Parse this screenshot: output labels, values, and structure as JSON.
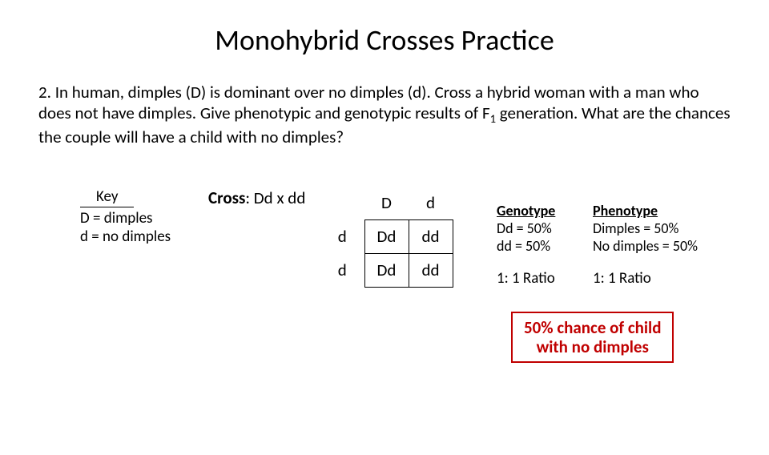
{
  "title": "Monohybrid Crosses Practice",
  "question_html": "2. In human, dimples (D) is dominant over no dimples (d). Cross a hybrid woman with a man who does not have dimples.  Give phenotypic and genotypic results of F<span class='sub'>1</span> generation.   What are the chances the couple will have a child with no dimples?",
  "key": {
    "heading": "Key",
    "line1": "D = dimples",
    "line2": "d = no dimples"
  },
  "cross": {
    "label": "Cross",
    "value": "Dd x dd"
  },
  "punnett": {
    "top": [
      "D",
      "d"
    ],
    "left": [
      "d",
      "d"
    ],
    "cells": [
      [
        "Dd",
        "dd"
      ],
      [
        "Dd",
        "dd"
      ]
    ]
  },
  "results": {
    "genotype_heading": "Genotype",
    "phenotype_heading": "Phenotype",
    "genotype": [
      "Dd = 50%",
      "dd = 50%"
    ],
    "phenotype": [
      "Dimples = 50%",
      "No dimples = 50%"
    ],
    "genotype_ratio": "1: 1 Ratio",
    "phenotype_ratio": "1: 1 Ratio"
  },
  "answer": {
    "line1": "50% chance of child",
    "line2": "with no dimples"
  }
}
